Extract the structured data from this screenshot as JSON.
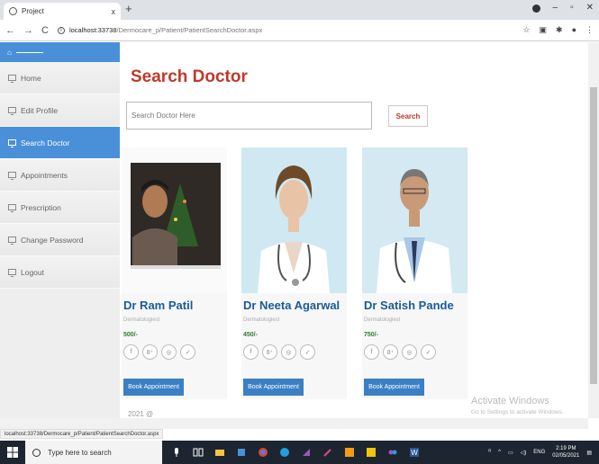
{
  "browser": {
    "tab_title": "Project",
    "tab_close": "x",
    "new_tab": "+",
    "url_host": "localhost:33738",
    "url_path": "/Dermocare_p/Patient/PatientSearchDoctor.aspx",
    "status_url": "localhost:33738/Dermocare_p/Patient/PatientSearchDoctor.aspx"
  },
  "sidebar": {
    "items": [
      {
        "label": "Home"
      },
      {
        "label": "Edit Profile"
      },
      {
        "label": "Search Doctor"
      },
      {
        "label": "Appointments"
      },
      {
        "label": "Prescription"
      },
      {
        "label": "Change Password"
      },
      {
        "label": "Logout"
      }
    ]
  },
  "main": {
    "title": "Search Doctor",
    "search_placeholder": "Search Doctor Here",
    "search_button": "Search",
    "footer": "2021 @"
  },
  "doctors": [
    {
      "name": "Dr Ram Patil",
      "specialty": "Dermatologiest",
      "fee": "500/-",
      "book_label": "Book Appointment"
    },
    {
      "name": "Dr Neeta Agarwal",
      "specialty": "Dermatologiest",
      "fee": "450/-",
      "book_label": "Book Appointment"
    },
    {
      "name": "Dr Satish Pande",
      "specialty": "Dermatologiest",
      "fee": "750/-",
      "book_label": "Book Appointment"
    }
  ],
  "social_icons": [
    "f",
    "8⁺",
    "◎",
    "✓"
  ],
  "watermark": {
    "title": "Activate Windows",
    "subtitle": "Go to Settings to activate Windows."
  },
  "taskbar": {
    "search_placeholder": "Type here to search",
    "time": "2:19 PM",
    "date": "02/05/2021",
    "lang": "ENG"
  }
}
